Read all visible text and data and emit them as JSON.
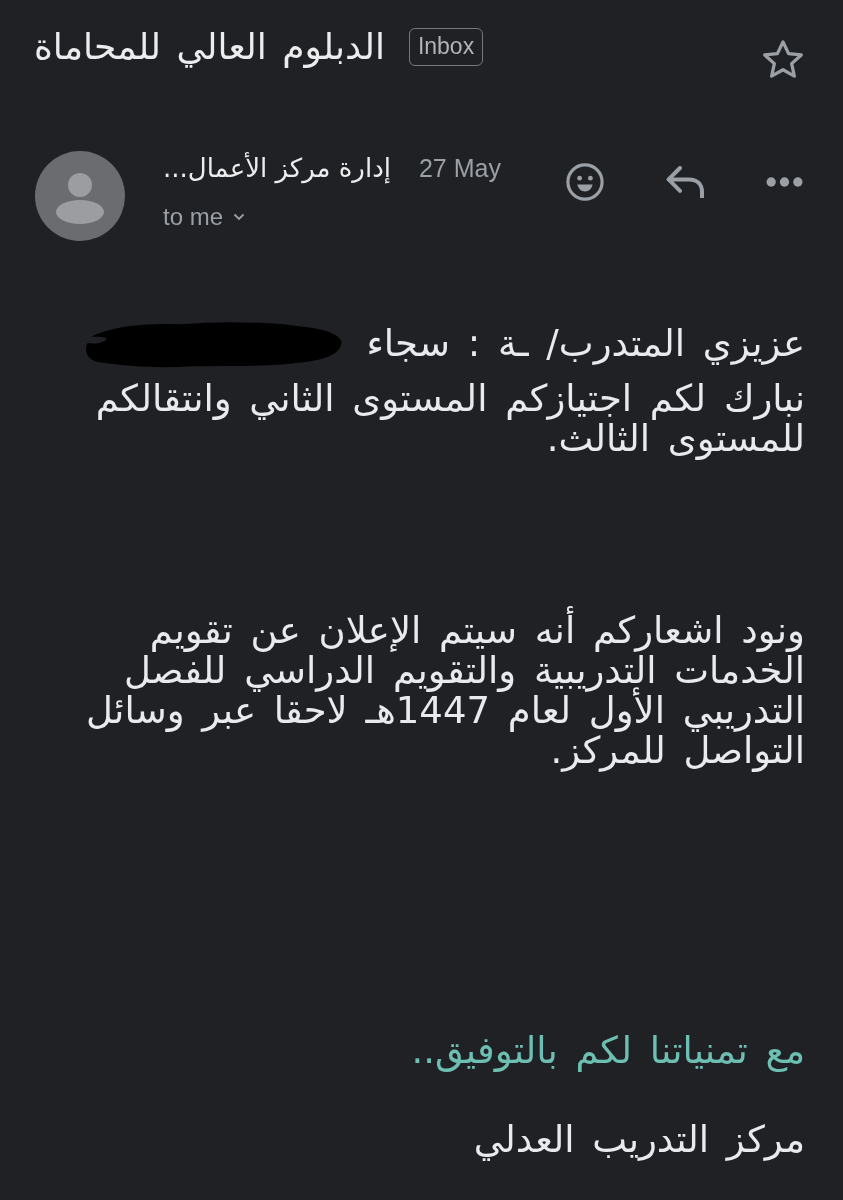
{
  "header": {
    "subject": "الدبلوم العالي للمحاماة",
    "label": "Inbox",
    "starred": false
  },
  "message": {
    "sender": "إدارة مركز الأعمال...",
    "date": "27 May",
    "recipient": "to me"
  },
  "body": {
    "greeting": "عزيزي المتدرب/ ـة : سجاء",
    "greeting_redacted": true,
    "paragraphs": [
      "نبارك لكم اجتيازكم المستوى الثاني وانتقالكم للمستوى الثالث.",
      "ونود اشعاركم أنه سيتم الإعلان عن تقويم الخدمات التدريبية والتقويم الدراسي للفصل التدريبي الأول لعام 1447هـ لاحقا عبر وسائل التواصل للمركز."
    ],
    "closing": "مع تمنياتنا لكم بالتوفيق..",
    "signature": "مركز التدريب العدلي"
  }
}
